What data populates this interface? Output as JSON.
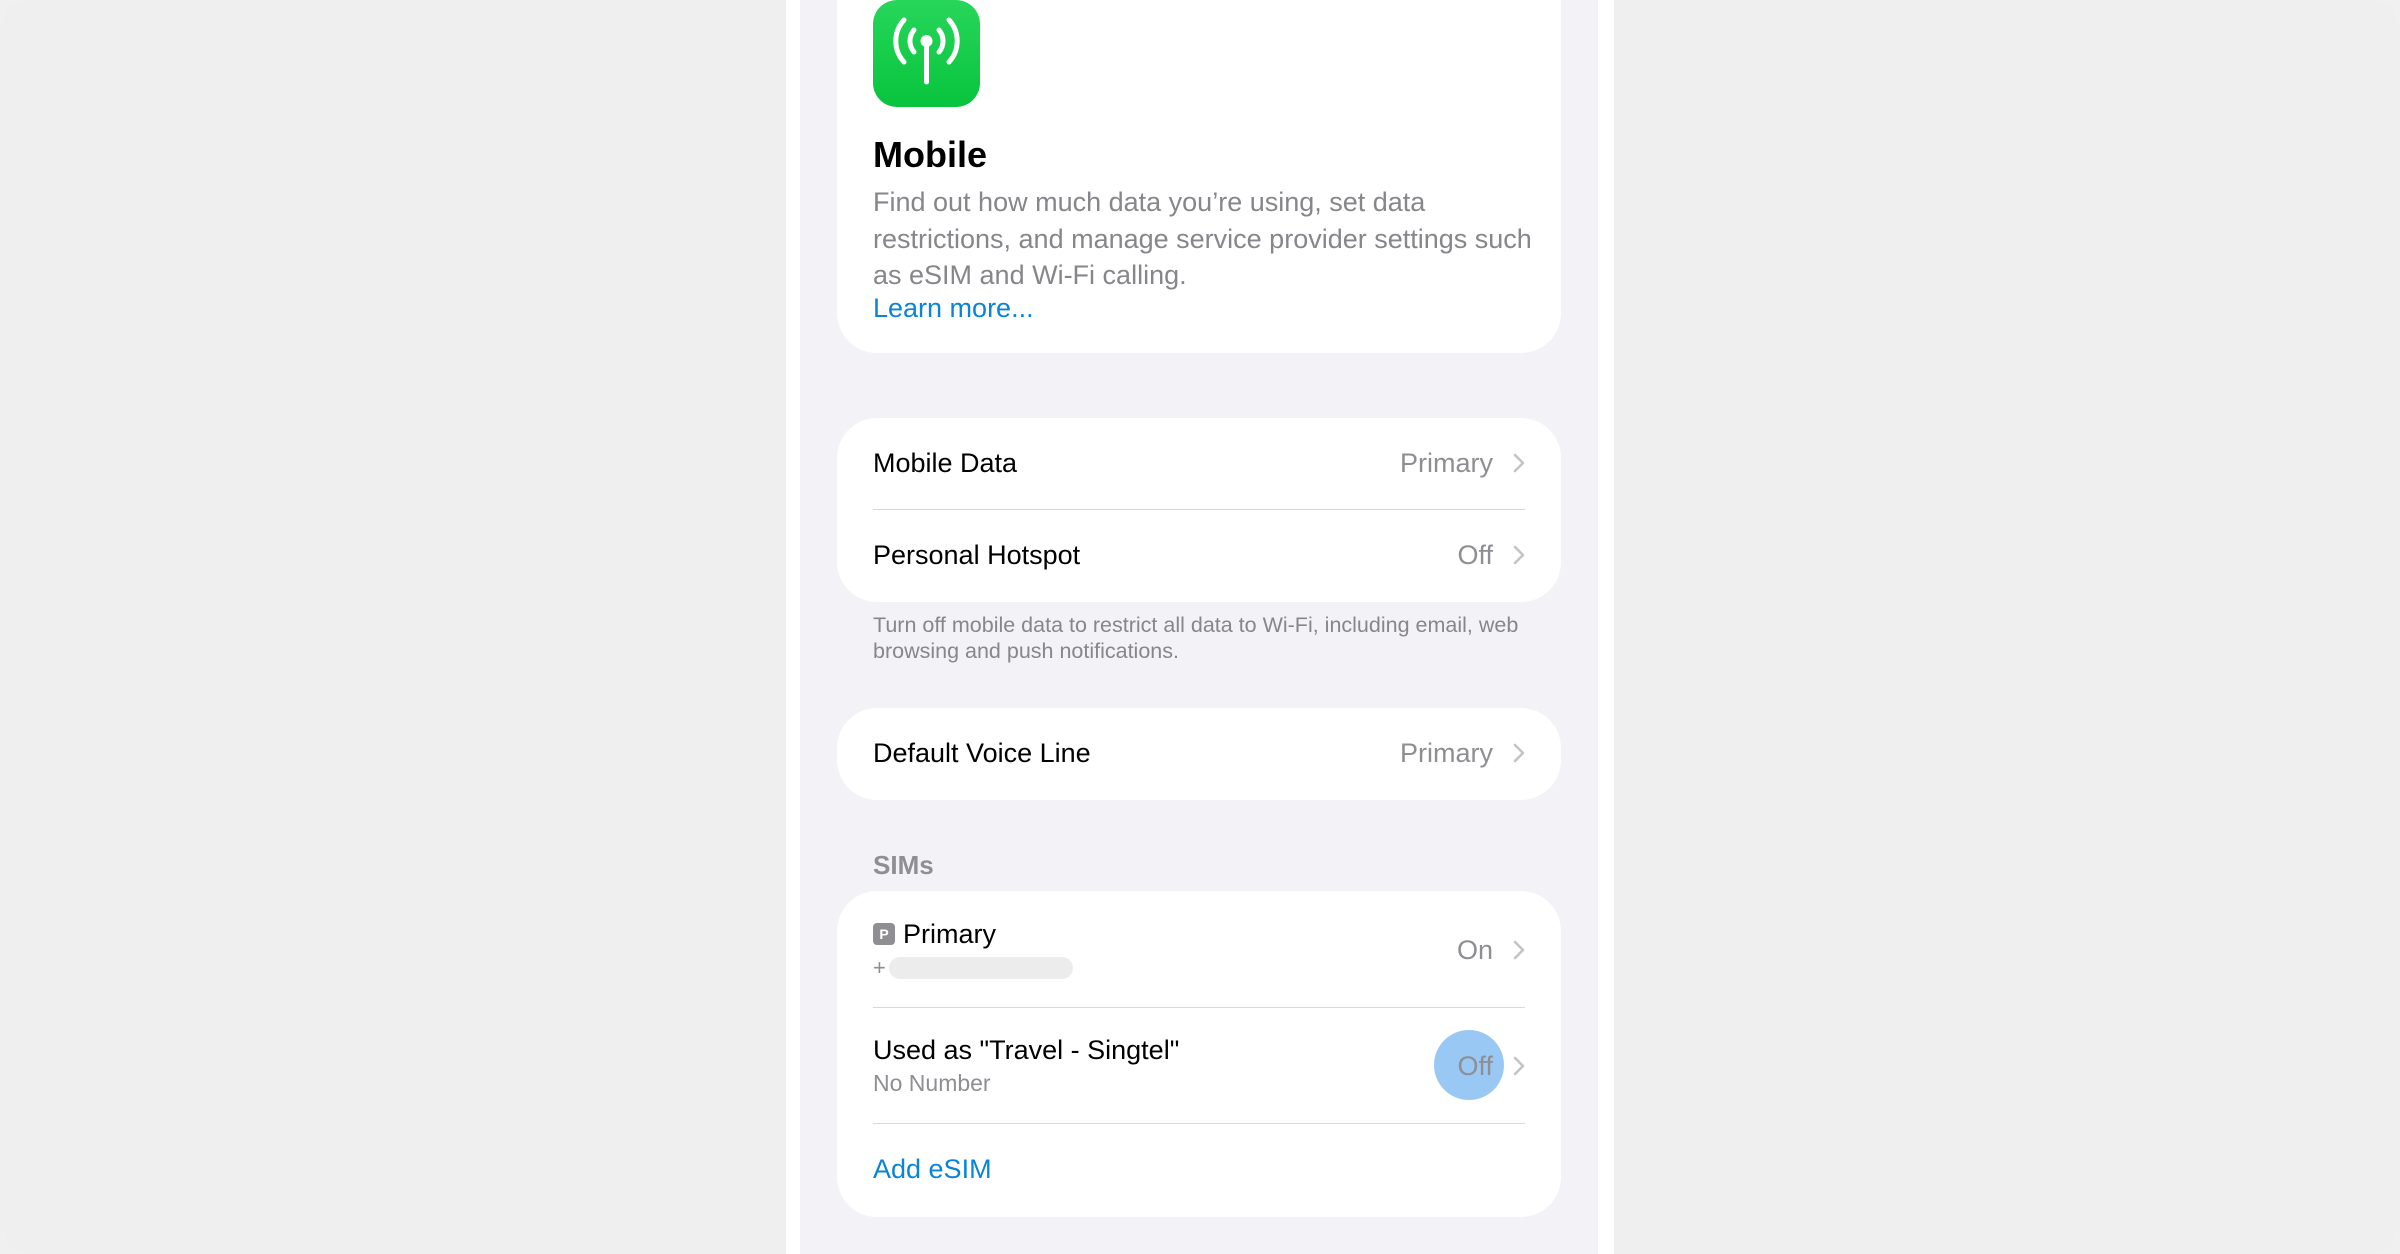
{
  "hero": {
    "icon": "antenna-icon",
    "title": "Mobile",
    "description": "Find out how much data you’re using, set data restrictions, and manage service provider settings such as eSIM and Wi-Fi calling.",
    "learn_more": "Learn more..."
  },
  "group1": {
    "rows": [
      {
        "label": "Mobile Data",
        "value": "Primary"
      },
      {
        "label": "Personal Hotspot",
        "value": "Off"
      }
    ],
    "footnote": "Turn off mobile data to restrict all data to Wi-Fi, including email, web browsing and push notifications."
  },
  "group2": {
    "rows": [
      {
        "label": "Default Voice Line",
        "value": "Primary"
      }
    ]
  },
  "sims": {
    "header": "SIMs",
    "primary": {
      "badge": "P",
      "name": "Primary",
      "number_prefix": "+",
      "status": "On"
    },
    "travel": {
      "name": "Used as \"Travel - Singtel\"",
      "subtitle": "No Number",
      "status": "Off"
    },
    "add_esim": "Add eSIM"
  },
  "colors": {
    "accent": "#0a84d6",
    "icon_green": "#08c43d",
    "secondary_text": "#8e8e93",
    "background": "#f2f2f7"
  }
}
